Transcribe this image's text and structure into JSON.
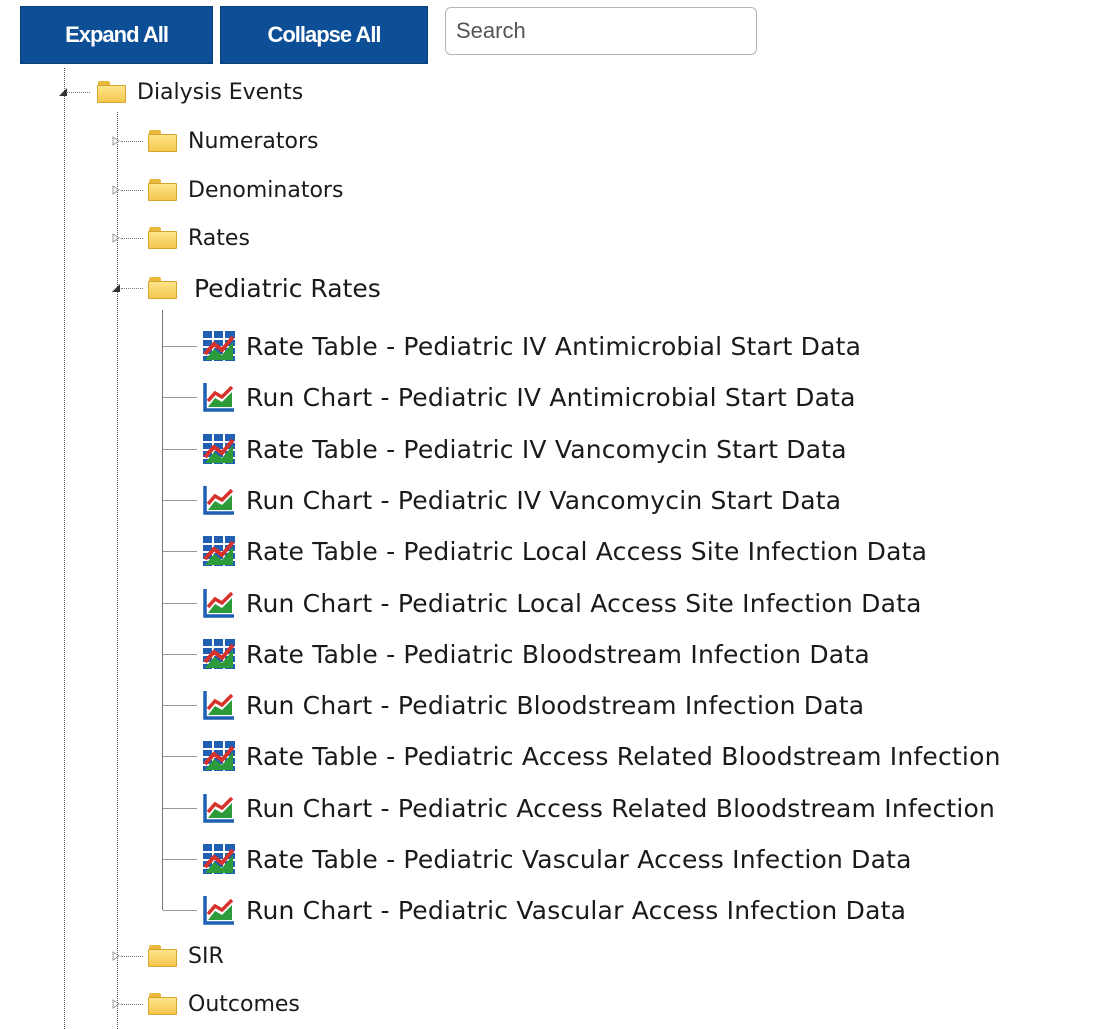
{
  "toolbar": {
    "expand_label": "Expand All",
    "collapse_label": "Collapse All",
    "search_placeholder": "Search"
  },
  "tree": {
    "root": {
      "label": "Dialysis Events",
      "icon": "folder-icon",
      "expanded": true
    },
    "folders": [
      {
        "label": "Numerators",
        "icon": "folder-icon",
        "expanded": false
      },
      {
        "label": "Denominators",
        "icon": "folder-icon",
        "expanded": false
      },
      {
        "label": "Rates",
        "icon": "folder-icon",
        "expanded": false
      },
      {
        "label": "Pediatric Rates",
        "icon": "folder-icon",
        "expanded": true
      },
      {
        "label": "SIR",
        "icon": "folder-icon",
        "expanded": false
      },
      {
        "label": "Outcomes",
        "icon": "folder-icon",
        "expanded": false
      }
    ],
    "pediatric_items": [
      {
        "label": "Rate Table - Pediatric IV Antimicrobial Start Data",
        "icon": "rate-table-icon"
      },
      {
        "label": "Run Chart - Pediatric IV Antimicrobial Start Data",
        "icon": "run-chart-icon"
      },
      {
        "label": "Rate Table - Pediatric IV Vancomycin Start Data",
        "icon": "rate-table-icon"
      },
      {
        "label": "Run Chart - Pediatric IV Vancomycin Start Data",
        "icon": "run-chart-icon"
      },
      {
        "label": "Rate Table - Pediatric Local Access Site Infection Data",
        "icon": "rate-table-icon"
      },
      {
        "label": "Run Chart - Pediatric Local Access Site Infection Data",
        "icon": "run-chart-icon"
      },
      {
        "label": "Rate Table - Pediatric Bloodstream Infection Data",
        "icon": "rate-table-icon"
      },
      {
        "label": "Run Chart - Pediatric Bloodstream Infection Data",
        "icon": "run-chart-icon"
      },
      {
        "label": "Rate Table - Pediatric Access Related Bloodstream Infection",
        "icon": "rate-table-icon"
      },
      {
        "label": "Run Chart - Pediatric Access Related Bloodstream Infection",
        "icon": "run-chart-icon"
      },
      {
        "label": "Rate Table - Pediatric Vascular Access Infection Data",
        "icon": "rate-table-icon"
      },
      {
        "label": "Run Chart - Pediatric Vascular Access Infection Data",
        "icon": "run-chart-icon"
      }
    ]
  },
  "colors": {
    "button_bg": "#0d4f96",
    "folder_yellow": "#f3c84d",
    "chart_blue": "#1f5fb4",
    "chart_red": "#d6312a",
    "chart_green": "#2e9b3a"
  }
}
